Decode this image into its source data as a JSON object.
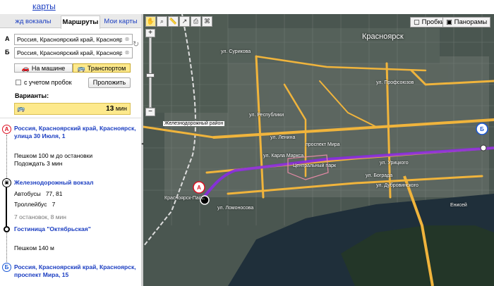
{
  "header": {
    "link": "карты"
  },
  "tabs": [
    {
      "label": "жд вокзалы",
      "active": false
    },
    {
      "label": "Маршруты",
      "active": true
    },
    {
      "label": "Мои карты",
      "active": false
    }
  ],
  "route_form": {
    "from_label": "А",
    "from_value": "Россия, Красноярский край, Красноярск",
    "to_label": "Б",
    "to_value": "Россия, Красноярский край, Красноярск",
    "mode_car": "На машине",
    "mode_transit": "Транспортом",
    "active_mode": "transit",
    "traffic_label": "с учетом пробок",
    "traffic_checked": false,
    "extend_button": "Проложить"
  },
  "variants": {
    "label": "Варианты:",
    "items": [
      {
        "time_value": "13",
        "time_unit": "мин",
        "selected": true
      }
    ]
  },
  "itinerary": {
    "start_marker": "А",
    "start_line1": "Россия, Красноярский край, Красноярск,",
    "start_line2": "улица 30 Июля, 1",
    "walk1_line1": "Пешком 100 м до остановки",
    "walk1_line2": "Подождать 3 мин",
    "stop1": "Железнодорожный вокзал",
    "bus_label": "Автобусы",
    "bus_value": "77, 81",
    "trolley_label": "Троллейбус",
    "trolley_value": "7",
    "stops_info": "7 остановок, 8 мин",
    "stop2": "Гостиница \"Октябрьская\"",
    "walk2": "Пешком 140 м",
    "end_marker": "Б",
    "end_line1": "Россия, Красноярский край, Красноярск,",
    "end_line2": "проспект Мира, 15"
  },
  "map": {
    "city_label": "Красноярск",
    "layer_traffic": "Пробки",
    "layer_panoramas": "Панорамы",
    "rail_label": "Железнодорожный район",
    "street_labels": [
      "ул. Республики",
      "ул. Ленина",
      "проспект Мира",
      "ул. Карла Маркса",
      "ул. Бограда",
      "ул. Дубровинского",
      "ул. Ломоносова",
      "Енисей",
      "Красноярск-Пасс.",
      "ул. Урицкого",
      "ул. Профсоюзов",
      "ул. Сурикова",
      "Центральный парк"
    ],
    "route_color": "#8a2be2",
    "start_marker": "А",
    "end_marker": "Б"
  },
  "colors": {
    "link": "#1a3dc1",
    "marker_a": "#dd1122",
    "marker_b": "#1a58d6",
    "highlight": "#fde98c",
    "road": "#f0b43c",
    "route": "#8a2be2"
  }
}
